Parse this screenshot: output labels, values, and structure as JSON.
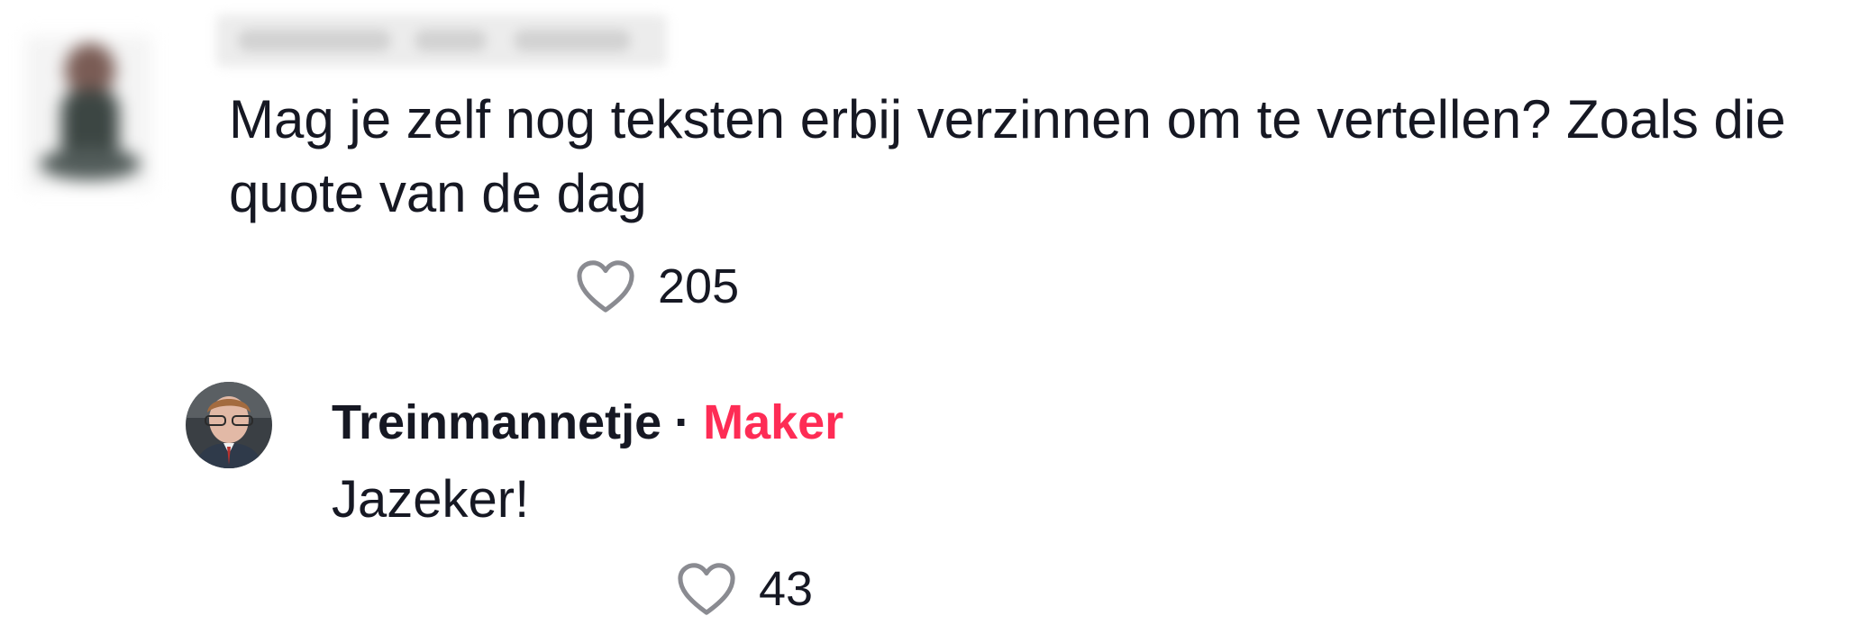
{
  "comment": {
    "text": "Mag je zelf nog teksten erbij verzinnen om te vertellen? Zoals die quote van de dag",
    "likes": "205",
    "like_icon": "heart-outline-icon"
  },
  "reply": {
    "author": "Treinmannetje",
    "separator": "·",
    "badge": "Maker",
    "badge_color": "#fe2c55",
    "text": "Jazeker!",
    "likes": "43",
    "like_icon": "heart-outline-icon"
  }
}
